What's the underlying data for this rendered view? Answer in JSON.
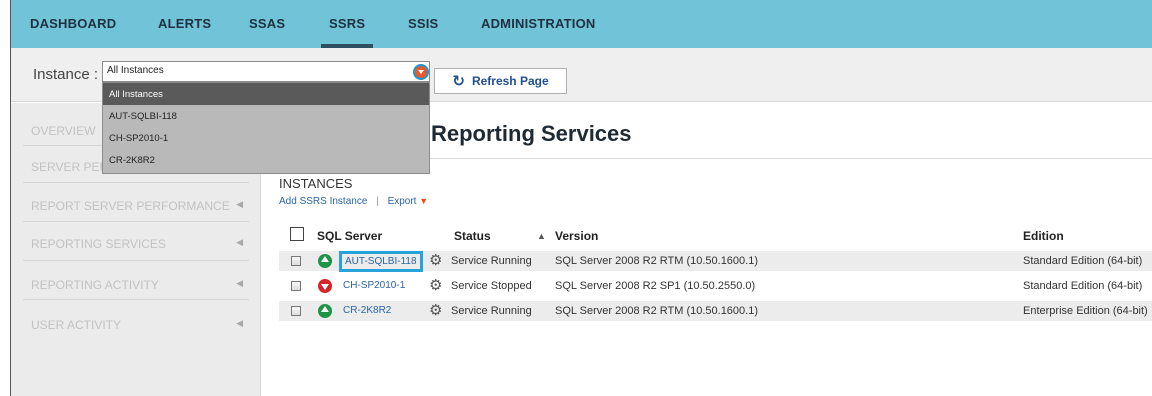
{
  "nav": {
    "tabs": [
      "DASHBOARD",
      "ALERTS",
      "SSAS",
      "SSRS",
      "SSIS",
      "ADMINISTRATION"
    ],
    "active": "SSRS"
  },
  "instance": {
    "label": "Instance :",
    "selected": "All Instances",
    "options": [
      "All Instances",
      "AUT-SQLBI-118",
      "CH-SP2010-1",
      "CR-2K8R2"
    ],
    "refresh_label": "Refresh Page",
    "refresh_icon": "refresh-icon"
  },
  "sidebar": {
    "items": [
      {
        "label": "OVERVIEW",
        "caret": ""
      },
      {
        "label": "SERVER PERFORMANCE",
        "caret": ""
      },
      {
        "label": "REPORT SERVER PERFORMANCE",
        "caret": "◀"
      },
      {
        "label": "REPORTING SERVICES",
        "caret": "◀"
      },
      {
        "label": "REPORTING ACTIVITY",
        "caret": "◀"
      },
      {
        "label": "USER ACTIVITY",
        "caret": "◀"
      }
    ]
  },
  "main": {
    "title": "Reporting Services",
    "section": "INSTANCES",
    "add_link": "Add SSRS Instance",
    "separator": "|",
    "export_link": "Export",
    "export_arrow": "▼"
  },
  "table": {
    "columns": {
      "server": "SQL Server",
      "status": "Status",
      "version": "Version",
      "edition": "Edition",
      "sort_arrow": "▲"
    },
    "rows": [
      {
        "server": "AUT-SQLBI-118",
        "state": "up",
        "status": "Service Running",
        "version": "SQL Server 2008 R2 RTM (10.50.1600.1)",
        "edition": "Standard Edition (64-bit)"
      },
      {
        "server": "CH-SP2010-1",
        "state": "down",
        "status": "Service Stopped",
        "version": "SQL Server 2008 R2 SP1 (10.50.2550.0)",
        "edition": "Standard Edition (64-bit)"
      },
      {
        "server": "CR-2K8R2",
        "state": "up",
        "status": "Service Running",
        "version": "SQL Server 2008 R2 RTM (10.50.1600.1)",
        "edition": "Enterprise Edition (64-bit)"
      }
    ]
  },
  "colors": {
    "nav_bg": "#71c3d8",
    "highlight": "#27a3db",
    "running": "#1e9446",
    "stopped": "#d3262b",
    "link": "#2a64a8"
  }
}
